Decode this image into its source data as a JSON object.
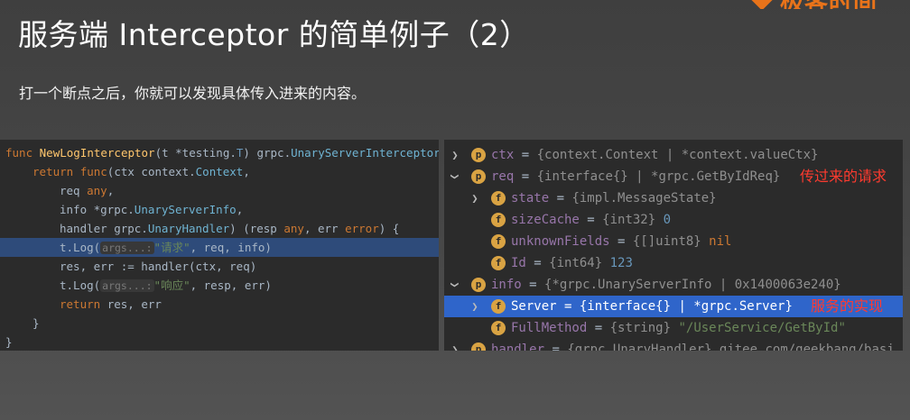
{
  "slide": {
    "title": "服务端 Interceptor 的简单例子（2）",
    "subtitle": "打一个断点之后，你就可以发现具体传入进来的内容。",
    "logo_text": "极客时间"
  },
  "code": {
    "l1_func": "func ",
    "l1_name": "NewLogInterceptor",
    "l1_params": "(t *testing.",
    "l1_T": "T",
    "l1_rest": ") grpc.",
    "l1_ret": "UnaryServerInterceptor",
    "l2_return": "return ",
    "l2_func": "func",
    "l2_rest": "(ctx context.",
    "l2_ctx": "Context",
    "l2_comma": ",",
    "l3_req": "req ",
    "l3_any": "any",
    "l3_comma": ",",
    "l4_info": "info *grpc.",
    "l4_type": "UnaryServerInfo",
    "l4_comma": ",",
    "l5_handler": "handler grpc.",
    "l5_type": "UnaryHandler",
    "l5_resp": ") (resp ",
    "l5_any": "any",
    "l5_err": ", err ",
    "l5_error": "error",
    "l5_brace": ") {",
    "l6_call": "t.Log(",
    "l6_hint": "args...:",
    "l6_str": "\"请求\"",
    "l6_rest": ", req, info)",
    "l7_text": "res, err := handler(ctx, req)",
    "l8_call": "t.Log(",
    "l8_hint": "args...:",
    "l8_str": "\"响应\"",
    "l8_rest": ", resp, err)",
    "l9_return": "return ",
    "l9_rest": "res, err",
    "l10": "}",
    "l11": "}"
  },
  "debugger": {
    "rows": [
      {
        "name": "ctx",
        "value": "{context.Context | *context.valueCtx}",
        "badge": "p"
      },
      {
        "name": "req",
        "value": "{interface{} | *grpc.GetByIdReq}",
        "badge": "p",
        "note": "传过来的请求"
      },
      {
        "name": "state",
        "value": "{impl.MessageState}",
        "badge": "f"
      },
      {
        "name": "sizeCache",
        "value": "{int32}",
        "num": "0",
        "badge": "f"
      },
      {
        "name": "unknownFields",
        "value": "{[]uint8}",
        "nil": "nil",
        "badge": "f"
      },
      {
        "name": "Id",
        "value": "{int64}",
        "num": "123",
        "badge": "f"
      },
      {
        "name": "info",
        "value": "{*grpc.UnaryServerInfo | 0x1400063e240}",
        "badge": "p"
      },
      {
        "name": "Server",
        "value": "{interface{} | *grpc.Server}",
        "badge": "f",
        "note": "服务的实现"
      },
      {
        "name": "FullMethod",
        "value": "{string}",
        "str": "\"/UserService/GetById\"",
        "badge": "f"
      },
      {
        "name": "handler",
        "value": "{grpc.UnaryHandler} gitee.com/geekbang/basi",
        "badge": "p"
      }
    ],
    "eq": " = "
  },
  "colors": {
    "accent": "#e8731a",
    "highlight_line": "#2e4b7a",
    "selected_row": "#2f65ca",
    "note_red": "#ff3b2f",
    "badge": "#d9a343"
  }
}
